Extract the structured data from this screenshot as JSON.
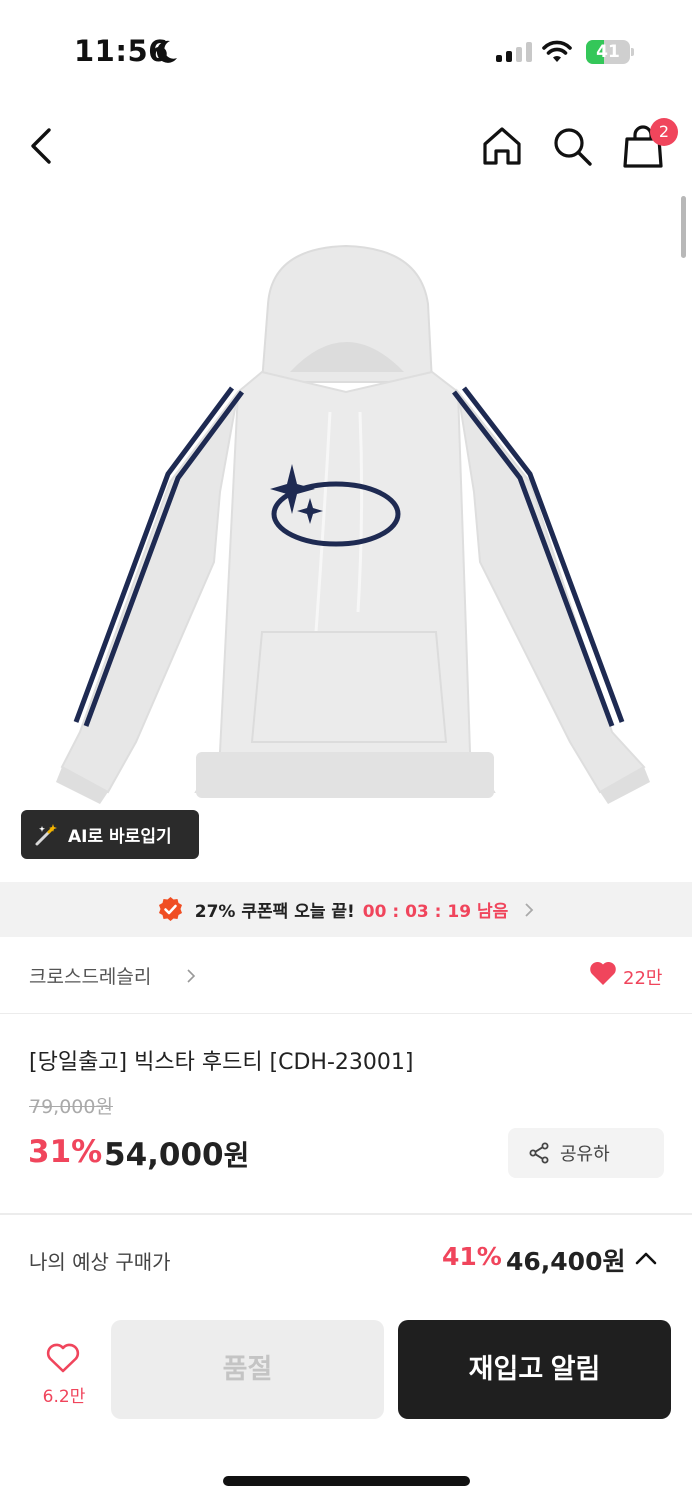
{
  "status_bar": {
    "time": "11:56",
    "battery": "41",
    "battery_level": 0.41,
    "icons": [
      "moon-icon",
      "cellular-signal-icon",
      "wifi-icon",
      "battery-charging-icon"
    ]
  },
  "nav": {
    "icons": [
      "back-chevron-icon",
      "home-icon",
      "search-icon",
      "shopping-bag-icon"
    ],
    "cart_badge": "2"
  },
  "product_image": {
    "alt": "[당일출고] 빅스타 후드티 [CDH-23001]",
    "colors": {
      "garment": "#ebebeb",
      "stripe": "#1e2a52",
      "print": "#1e2a52"
    }
  },
  "ai_fitting": {
    "label": "AI로 바로입기",
    "icon": "magic-wand-icon"
  },
  "coupon_banner": {
    "text": "27% 쿠폰팩 오늘 끝!",
    "countdown": "00 : 03 : 19 남음",
    "icons": [
      "verified-badge-icon",
      "chevron-right-icon"
    ]
  },
  "brand": {
    "name": "크로스드레슬리",
    "wish_count": "22만"
  },
  "product": {
    "title": "[당일출고] 빅스타 후드티 [CDH-23001]",
    "original_price": "79,000원",
    "discount_rate": "31%",
    "sale_price": "54,000",
    "price_unit": "원",
    "share_label": "공유하"
  },
  "expected_price": {
    "label": "나의 예상 구매가",
    "rate": "41%",
    "price": "46,400원"
  },
  "bottom_bar": {
    "like_count": "6.2만",
    "soldout_label": "품절",
    "restock_label": "재입고 알림"
  },
  "colors": {
    "accent": "#f0455c",
    "dark_button": "#1f1f1f",
    "disabled_button": "#ededed"
  }
}
